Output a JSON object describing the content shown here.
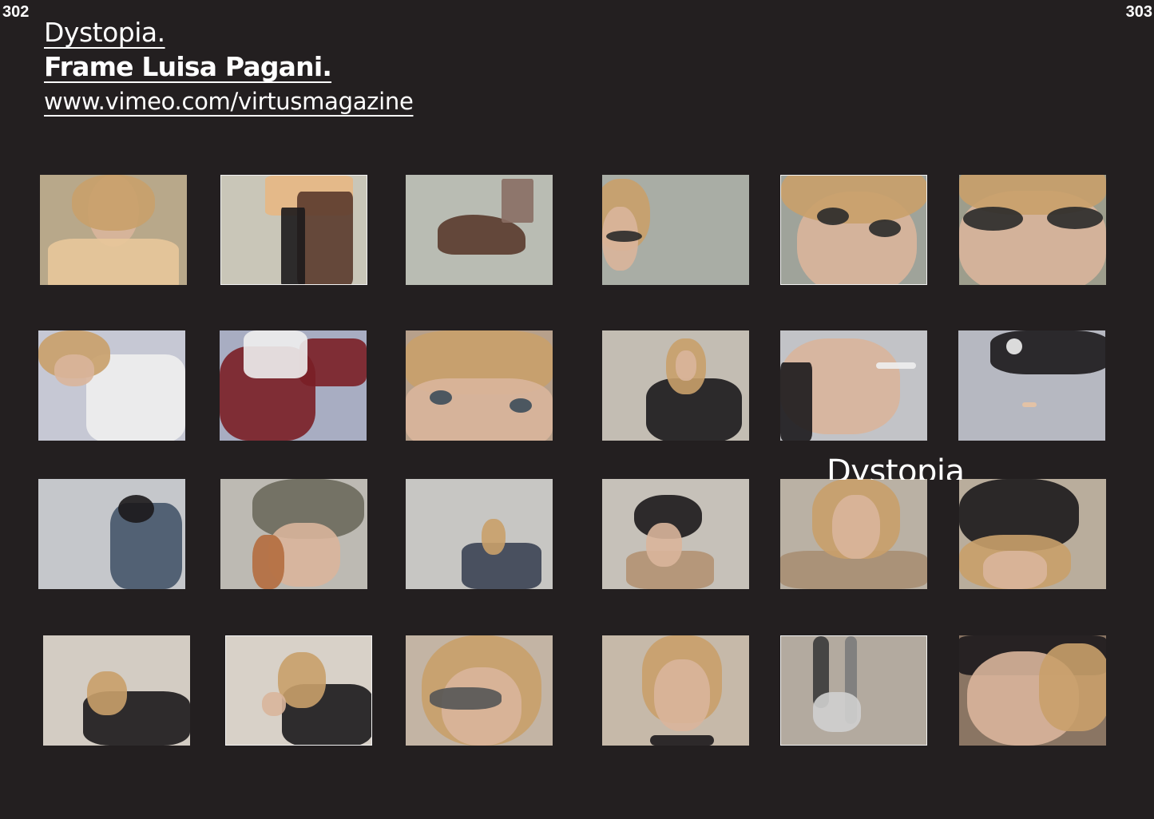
{
  "page_numbers": {
    "left": "302",
    "right": "303"
  },
  "header": {
    "title": "Dystopia.",
    "credit": "Frame Luisa Pagani.",
    "url": "www.vimeo.com/virtusmagazine"
  },
  "overlay_title": "Dystopia",
  "colors": {
    "background": "#231f20",
    "text": "#ffffff",
    "frame_border": "#f2f2f2"
  },
  "frames": [
    {
      "subject": "model-with-long-hair-in-pastel-tee",
      "bordered": false,
      "bg": "#b8a88a"
    },
    {
      "subject": "hands-holding-dark-jacket",
      "bordered": true,
      "bg": "#c9c6b8"
    },
    {
      "subject": "brown-leather-boot",
      "bordered": false,
      "bg": "#b9bcb3"
    },
    {
      "subject": "profile-with-small-sunglasses",
      "bordered": false,
      "bg": "#a9ada5"
    },
    {
      "subject": "close-up-cat-eye-sunglasses",
      "bordered": true,
      "bg": "#9fa39a"
    },
    {
      "subject": "extreme-close-up-sunglasses",
      "bordered": false,
      "bg": "#9d9d8c"
    },
    {
      "subject": "model-bending-in-white-shirt",
      "bordered": false,
      "bg": "#c6c8d4"
    },
    {
      "subject": "red-coat-and-trousers",
      "bordered": false,
      "bg": "#a8adc2"
    },
    {
      "subject": "eyes-close-up",
      "bordered": false,
      "bg": "#b7a08b"
    },
    {
      "subject": "seated-model-in-black",
      "bordered": false,
      "bg": "#c3bdb3"
    },
    {
      "subject": "hand-holding-cigarette",
      "bordered": false,
      "bg": "#c2c3c7"
    },
    {
      "subject": "black-shoe-and-cigarette",
      "bordered": false,
      "bg": "#b6b8c1"
    },
    {
      "subject": "model-in-bucket-hat-and-puffer",
      "bordered": false,
      "bg": "#c5c7cb"
    },
    {
      "subject": "close-up-bucket-hat",
      "bordered": false,
      "bg": "#bdbab3"
    },
    {
      "subject": "model-crouching-in-studio",
      "bordered": false,
      "bg": "#c7c6c3"
    },
    {
      "subject": "model-in-black-cap",
      "bordered": false,
      "bg": "#c6c1b9"
    },
    {
      "subject": "model-holding-coat-collar",
      "bordered": false,
      "bg": "#bab1a4"
    },
    {
      "subject": "close-up-black-cap",
      "bordered": false,
      "bg": "#b9ad9c"
    },
    {
      "subject": "model-crouching-in-black-coat",
      "bordered": false,
      "bg": "#d3ccc3"
    },
    {
      "subject": "model-removing-glasses",
      "bordered": true,
      "bg": "#d8d1c8"
    },
    {
      "subject": "close-up-grey-sunglasses",
      "bordered": false,
      "bg": "#c3b4a4"
    },
    {
      "subject": "holding-sunglasses-to-camera",
      "bordered": false,
      "bg": "#c6b9a9"
    },
    {
      "subject": "falling-sunglasses",
      "bordered": true,
      "bg": "#b3aa9f"
    },
    {
      "subject": "face-lying-down",
      "bordered": false,
      "bg": "#8a7563"
    }
  ]
}
